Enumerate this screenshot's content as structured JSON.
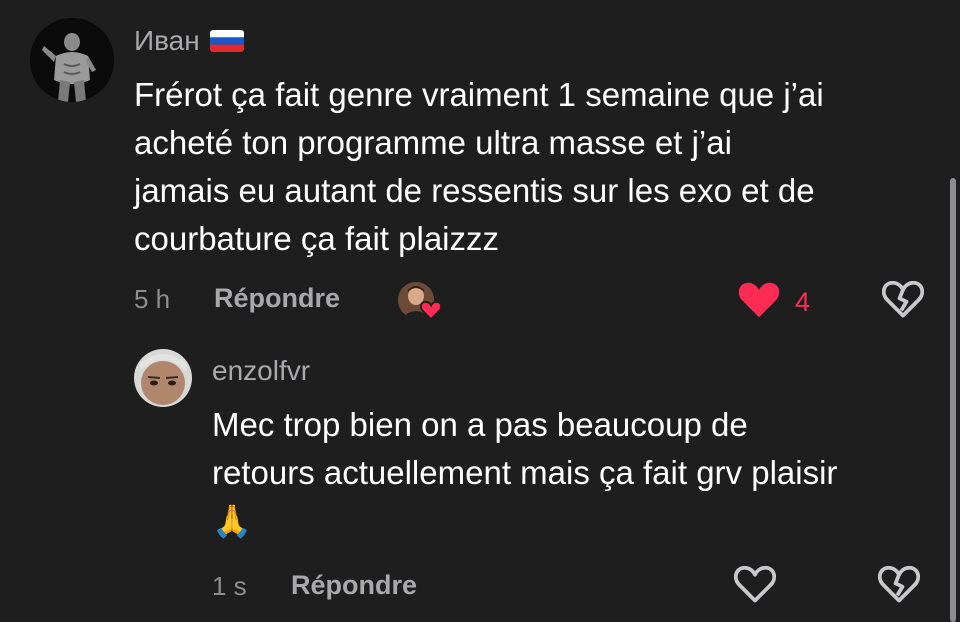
{
  "comments": [
    {
      "author": "Иван",
      "flag": "🇷🇺",
      "text_lines": [
        "Frérot ça fait genre vraiment 1 semaine que j’ai",
        "acheté ton programme ultra masse et j’ai",
        "jamais eu autant de ressentis sur les exo et de",
        "courbature ça fait plaizzz"
      ],
      "time": "5 h",
      "reply_label": "Répondre",
      "likes": "4",
      "liked": true,
      "colors": {
        "like": "#fe2c55"
      }
    },
    {
      "author": "enzolfvr",
      "text_lines": [
        "Mec trop bien on a pas beaucoup de",
        "retours actuellement mais ça fait grv plaisir"
      ],
      "emoji": "🙏",
      "time": "1 s",
      "reply_label": "Répondre",
      "liked": false
    }
  ],
  "icons": {
    "like": "heart-icon",
    "dislike": "broken-heart-icon",
    "creator_liked": "creator-liked-badge"
  },
  "colors": {
    "background": "#1f1e1f",
    "name": "#a9a9ab",
    "meta": "#8e8e90",
    "like_active": "#fe2c55"
  }
}
